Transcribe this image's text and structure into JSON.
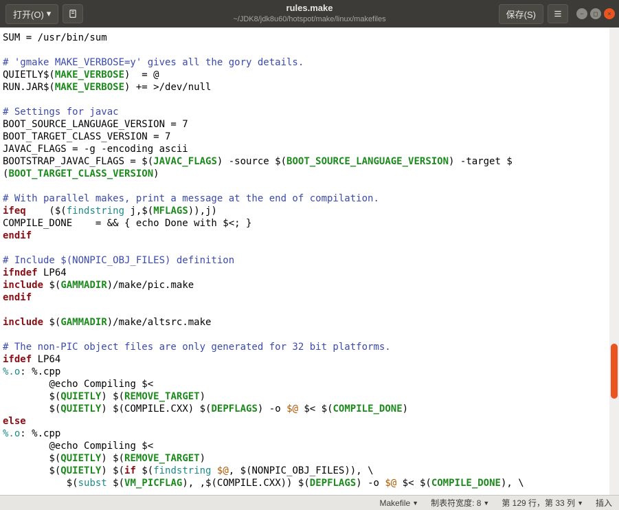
{
  "titlebar": {
    "open_label": "打开(O)",
    "title": "rules.make",
    "path": "~/JDK8/jdk8u60/hotspot/make/linux/makefiles",
    "save_label": "保存(S)"
  },
  "code": {
    "l1": "SUM = /usr/bin/sum",
    "l3": "# 'gmake MAKE_VERBOSE=y' gives all the gory details.",
    "l4a": "QUIETLY$(",
    "l4b": "MAKE_VERBOSE",
    "l4c": ")  = @",
    "l5a": "RUN.JAR$(",
    "l5b": "MAKE_VERBOSE",
    "l5c": ") += >/dev/null",
    "l7": "# Settings for javac",
    "l8": "BOOT_SOURCE_LANGUAGE_VERSION = 7",
    "l9": "BOOT_TARGET_CLASS_VERSION = 7",
    "l10": "JAVAC_FLAGS = -g -encoding ascii",
    "l11a": "BOOTSTRAP_JAVAC_FLAGS = $(",
    "l11b": "JAVAC_FLAGS",
    "l11c": ") -source $(",
    "l11d": "BOOT_SOURCE_LANGUAGE_VERSION",
    "l11e": ") -target $",
    "l12a": "(",
    "l12b": "BOOT_TARGET_CLASS_VERSION",
    "l12c": ")",
    "l14": "# With parallel makes, print a message at the end of compilation.",
    "l15a": "ifeq",
    "l15b": "    ($(",
    "l15c": "findstring",
    "l15d": " j,$(",
    "l15e": "MFLAGS",
    "l15f": ")),j)",
    "l16": "COMPILE_DONE    = && { echo Done with $<; }",
    "l17": "endif",
    "l19": "# Include $(NONPIC_OBJ_FILES) definition",
    "l20a": "ifndef",
    "l20b": " LP64",
    "l21a": "include",
    "l21b": " $(",
    "l21c": "GAMMADIR",
    "l21d": ")/make/pic.make",
    "l22": "endif",
    "l24a": "include",
    "l24b": " $(",
    "l24c": "GAMMADIR",
    "l24d": ")/make/altsrc.make",
    "l26": "# The non-PIC object files are only generated for 32 bit platforms.",
    "l27a": "ifdef",
    "l27b": " LP64",
    "l28a": "%.o",
    "l28b": ": %.cpp",
    "l29": "\t@echo Compiling $<",
    "l30a": "\t$(",
    "l30b": "QUIETLY",
    "l30c": ") $(",
    "l30d": "REMOVE_TARGET",
    "l30e": ")",
    "l31a": "\t$(",
    "l31b": "QUIETLY",
    "l31c": ") $(COMPILE.CXX) $(",
    "l31d": "DEPFLAGS",
    "l31e": ") -o ",
    "l31f": "$@",
    "l31g": " $< $(",
    "l31h": "COMPILE_DONE",
    "l31i": ")",
    "l32": "else",
    "l33a": "%.o",
    "l33b": ": %.cpp",
    "l34": "\t@echo Compiling $<",
    "l35a": "\t$(",
    "l35b": "QUIETLY",
    "l35c": ") $(",
    "l35d": "REMOVE_TARGET",
    "l35e": ")",
    "l36a": "\t$(",
    "l36b": "QUIETLY",
    "l36c": ") $(",
    "l36d": "if",
    "l36e": " $(",
    "l36f": "findstring",
    "l36g": " ",
    "l36h": "$@",
    "l36i": ", $(NONPIC_OBJ_FILES)), \\",
    "l37a": "\t   $(",
    "l37b": "subst",
    "l37c": " $(",
    "l37d": "VM_PICFLAG",
    "l37e": "), ,$(COMPILE.CXX)) $(",
    "l37f": "DEPFLAGS",
    "l37g": ") -o ",
    "l37h": "$@",
    "l37i": " $< $(",
    "l37j": "COMPILE_DONE",
    "l37k": "), \\"
  },
  "statusbar": {
    "language": "Makefile",
    "tab_width": "制表符宽度: 8",
    "position": "第 129 行，第 33 列",
    "insert_mode": "插入"
  }
}
